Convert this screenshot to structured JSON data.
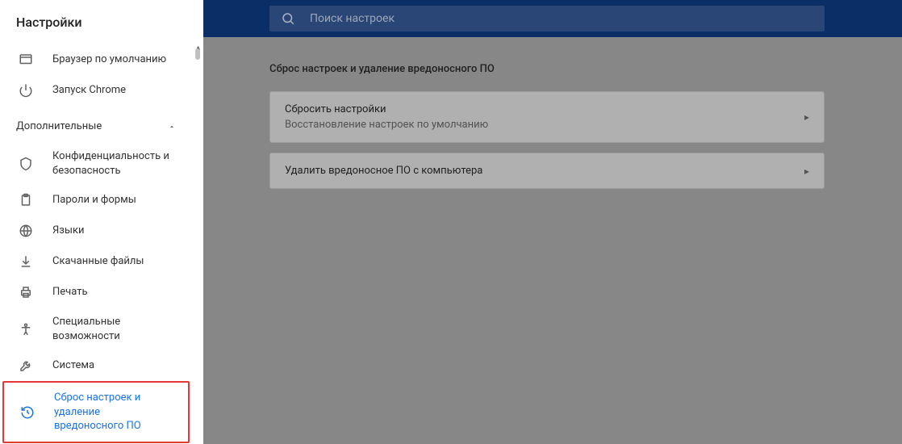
{
  "sidebar": {
    "title": "Настройки",
    "items_top": [
      {
        "icon": "browser",
        "label": "Браузер по умолчанию"
      },
      {
        "icon": "power",
        "label": "Запуск Chrome"
      }
    ],
    "section_label": "Дополнительные",
    "items_adv": [
      {
        "icon": "shield",
        "label": "Конфиденциальность и безопасность"
      },
      {
        "icon": "clipboard",
        "label": "Пароли и формы"
      },
      {
        "icon": "globe",
        "label": "Языки"
      },
      {
        "icon": "download",
        "label": "Скачанные файлы"
      },
      {
        "icon": "print",
        "label": "Печать"
      },
      {
        "icon": "a11y",
        "label": "Специальные возможности"
      },
      {
        "icon": "wrench",
        "label": "Система"
      },
      {
        "icon": "restore",
        "label": "Сброс настроек и удаление вредоносного ПО",
        "selected": true
      }
    ]
  },
  "header": {
    "search_placeholder": "Поиск настроек"
  },
  "main": {
    "section_title": "Сброс настроек и удаление вредоносного ПО",
    "cards": [
      {
        "title": "Сбросить настройки",
        "sub": "Восстановление настроек по умолчанию"
      },
      {
        "title": "Удалить вредоносное ПО с компьютера",
        "sub": ""
      }
    ]
  }
}
